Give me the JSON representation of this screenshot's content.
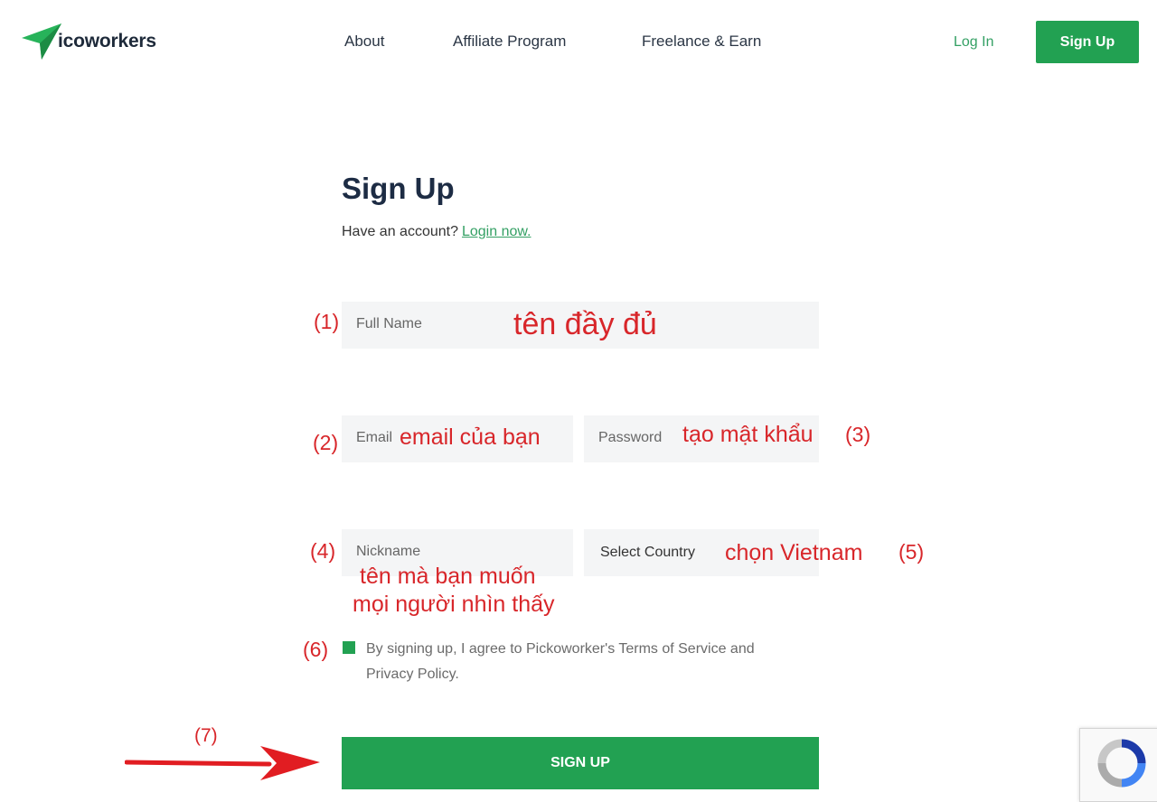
{
  "header": {
    "logo_text": "icoworkers",
    "nav": [
      "About",
      "Affiliate Program",
      "Freelance & Earn"
    ],
    "login_label": "Log In",
    "signup_label": "Sign Up"
  },
  "form": {
    "title": "Sign Up",
    "have_account": "Have an account?",
    "login_now": "Login now.",
    "fullname_placeholder": "Full Name",
    "email_placeholder": "Email",
    "password_placeholder": "Password",
    "nickname_placeholder": "Nickname",
    "country_placeholder": "Select Country",
    "terms_line1": "By signing up, I agree to Pickoworker's Terms of Service and",
    "terms_line2": "Privacy Policy.",
    "submit_label": "SIGN UP"
  },
  "annotations": {
    "n1": "(1)",
    "n2": "(2)",
    "n3": "(3)",
    "n4": "(4)",
    "n5": "(5)",
    "n6": "(6)",
    "n7": "(7)",
    "fullname": "tên đầy đủ",
    "email": "email của bạn",
    "password": "tạo mật khẩu",
    "nickname_line1": "tên mà bạn muốn",
    "nickname_line2": "mọi người nhìn thấy",
    "country": "chọn Vietnam"
  },
  "colors": {
    "brand_green": "#22a152",
    "annotation_red": "#d8262a",
    "field_bg": "#f4f5f6"
  },
  "icons": {
    "logo": "paper-plane-icon",
    "arrow": "arrow-right-icon",
    "recaptcha": "recaptcha-icon"
  }
}
